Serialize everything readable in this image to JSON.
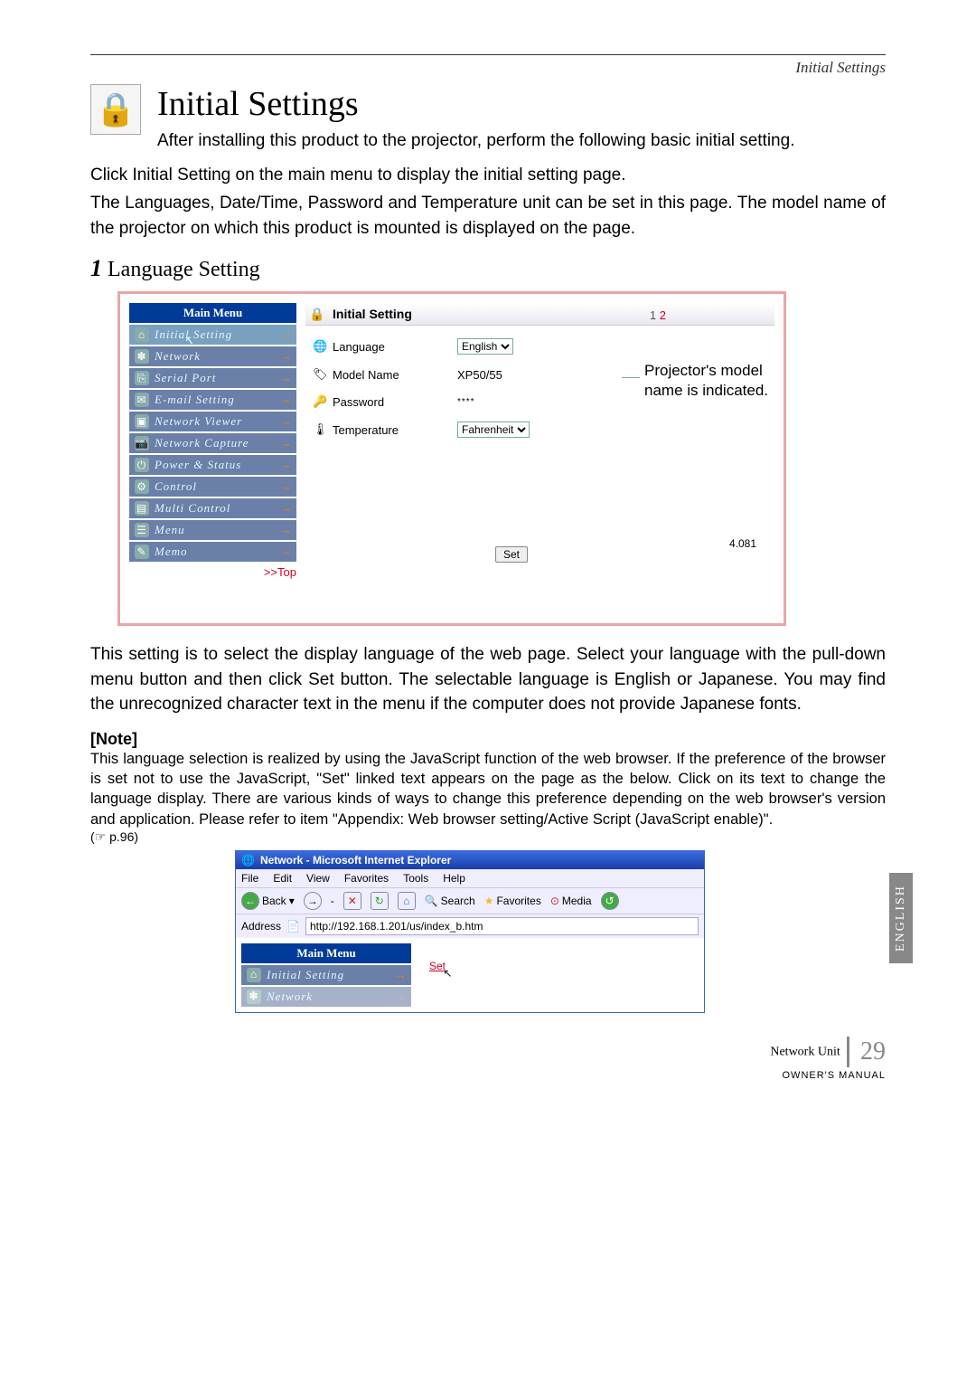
{
  "header": {
    "running_title": "Initial Settings"
  },
  "title": "Initial Settings",
  "intro": "After installing this product to the projector, perform the following basic initial setting.",
  "para1": "Click Initial Setting on the main menu to display the initial setting page.",
  "para2": "The Languages, Date/Time, Password and Temperature unit can be set in this page. The model name of the projector on which this product is mounted is displayed on the page.",
  "section_num": "1",
  "section_title": "Language Setting",
  "main_menu": {
    "title": "Main Menu",
    "items": [
      "Initial Setting",
      "Network",
      "Serial Port",
      "E-mail Setting",
      "Network Viewer",
      "Network Capture",
      "Power & Status",
      "Control",
      "Multi Control",
      "Menu",
      "Memo"
    ],
    "top_link": ">>Top"
  },
  "panel": {
    "title": "Initial Setting",
    "pages_current": "1",
    "pages_other": "2",
    "rows": {
      "language_label": "Language",
      "language_value": "English",
      "model_label": "Model Name",
      "model_value": "XP50/55",
      "password_label": "Password",
      "password_value": "****",
      "temperature_label": "Temperature",
      "temperature_value": "Fahrenheit"
    },
    "set_button": "Set",
    "version": "4.081"
  },
  "callout": "Projector's model name is indicated.",
  "body2": "This setting is to select the display language of the web page. Select your language with the pull-down menu button and then click Set button. The selectable language is English or Japanese. You may find the unrecognized character text in the menu if the computer does not provide Japanese fonts.",
  "note": {
    "heading": "[Note]",
    "body": "This language selection is realized by using the JavaScript function of the web browser. If the preference of the browser is set not to use the JavaScript, \"Set\" linked text appears on the page as the below. Click on its text to change the language display. There are various kinds of ways to change this preference depending on the web browser's version and application. Please refer to item \"Appendix: Web browser setting/Active Script (JavaScript enable)\".",
    "ref": "(☞ p.96)"
  },
  "ie": {
    "title": "Network - Microsoft Internet Explorer",
    "menu": [
      "File",
      "Edit",
      "View",
      "Favorites",
      "Tools",
      "Help"
    ],
    "toolbar": {
      "back": "Back",
      "search": "Search",
      "favorites": "Favorites",
      "media": "Media"
    },
    "address_label": "Address",
    "url": "http://192.168.1.201/us/index_b.htm",
    "mm_title": "Main Menu",
    "mm_items": [
      "Initial Setting",
      "Network"
    ],
    "set_link": "Set"
  },
  "side_tab": "ENGLISH",
  "footer": {
    "network_unit": "Network Unit",
    "owners": "OWNER'S MANUAL",
    "page": "29"
  }
}
